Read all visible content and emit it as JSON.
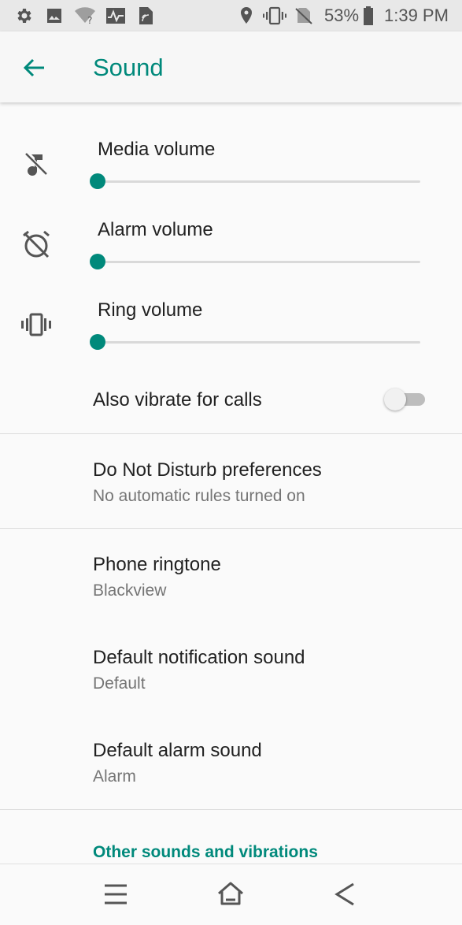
{
  "status_bar": {
    "icons": [
      "gear-icon",
      "image-icon",
      "wifi-question-icon",
      "activity-icon",
      "sim-icon",
      "location-icon",
      "vibrate-icon",
      "no-sim-icon",
      "battery-icon"
    ],
    "battery_percent": "53%",
    "time": "1:39 PM"
  },
  "app_bar": {
    "title": "Sound",
    "back_icon": "arrow-left-icon"
  },
  "volumes": [
    {
      "label": "Media volume",
      "icon": "music-off-icon",
      "level": 0
    },
    {
      "label": "Alarm volume",
      "icon": "alarm-off-icon",
      "level": 0
    },
    {
      "label": "Ring volume",
      "icon": "vibrate-icon",
      "level": 0
    }
  ],
  "vibrate_toggle": {
    "label": "Also vibrate for calls",
    "checked": false
  },
  "preferences": [
    {
      "title": "Do Not Disturb preferences",
      "summary": "No automatic rules turned on"
    },
    {
      "title": "Phone ringtone",
      "summary": "Blackview"
    },
    {
      "title": "Default notification sound",
      "summary": "Default"
    },
    {
      "title": "Default alarm sound",
      "summary": "Alarm"
    }
  ],
  "section_header": "Other sounds and vibrations",
  "nav_bar": {
    "buttons": [
      "menu-icon",
      "home-icon",
      "back-icon"
    ]
  },
  "colors": {
    "accent": "#00897b",
    "text_primary": "#212121",
    "text_secondary": "#757575"
  }
}
